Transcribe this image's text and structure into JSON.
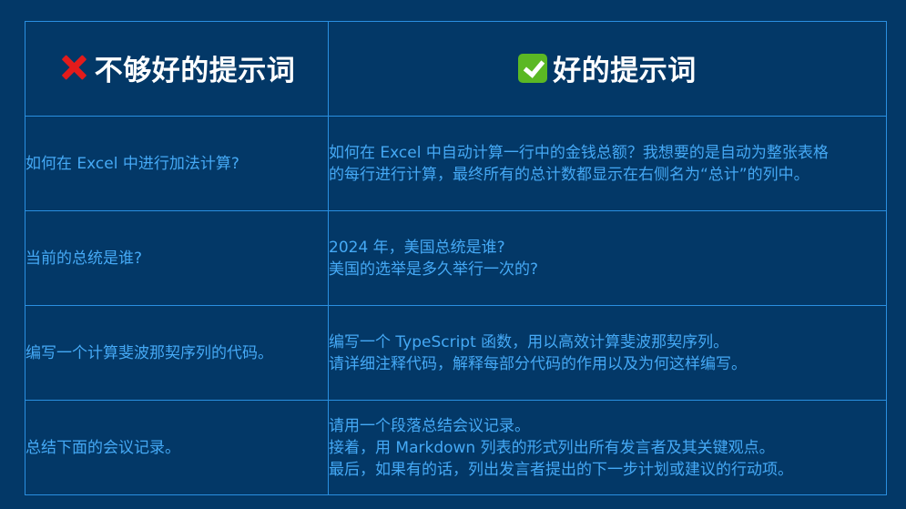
{
  "header": {
    "bad_label": "不够好的提示词",
    "good_label": "好的提示词",
    "bad_icon": "cross-mark-icon",
    "good_icon": "check-mark-icon"
  },
  "rows": [
    {
      "bad": "如何在 Excel 中进行加法计算?",
      "good": [
        "如何在 Excel 中自动计算一行中的金钱总额？我想要的是自动为整张表格",
        "的每行进行计算，最终所有的总计数都显示在右侧名为“总计”的列中。"
      ]
    },
    {
      "bad": "当前的总统是谁?",
      "good": [
        "2024 年，美国总统是谁?",
        "美国的选举是多久举行一次的?"
      ]
    },
    {
      "bad": "编写一个计算斐波那契序列的代码。",
      "good": [
        "编写一个 TypeScript 函数，用以高效计算斐波那契序列。",
        "请详细注释代码，解释每部分代码的作用以及为何这样编写。"
      ]
    },
    {
      "bad": "总结下面的会议记录。",
      "good": [
        "请用一个段落总结会议记录。",
        "接着，用 Markdown 列表的形式列出所有发言者及其关键观点。",
        "最后，如果有的话，列出发言者提出的下一步计划或建议的行动项。"
      ]
    }
  ],
  "colors": {
    "background": "#033867",
    "border": "#2a8fe0",
    "cell_text": "#45a9f5",
    "header_text": "#ffffff",
    "cross": "#e31b1b",
    "check": "#5bb824"
  }
}
